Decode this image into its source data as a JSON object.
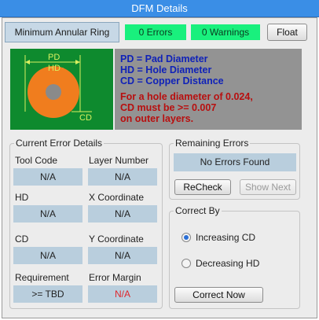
{
  "window": {
    "title": "DFM Details"
  },
  "header": {
    "tab_label": "Minimum Annular Ring",
    "errors_label": "0 Errors",
    "warnings_label": "0 Warnings",
    "float_label": "Float"
  },
  "diagram": {
    "pd_label": "PD",
    "hd_label": "HD",
    "cd_label": "CD",
    "legend_pd": "PD = Pad Diameter",
    "legend_hd": "HD = Hole Diameter",
    "legend_cd": "CD = Copper Distance",
    "note_line1": "For a hole diameter of 0.024,",
    "note_line2": "CD must be >= 0.007",
    "note_line3": "on outer layers."
  },
  "current_error": {
    "title": "Current Error Details",
    "tool_code_label": "Tool Code",
    "tool_code_value": "N/A",
    "layer_number_label": "Layer Number",
    "layer_number_value": "N/A",
    "hd_label": "HD",
    "hd_value": "N/A",
    "x_coord_label": "X Coordinate",
    "x_coord_value": "N/A",
    "cd_label": "CD",
    "cd_value": "N/A",
    "y_coord_label": "Y Coordinate",
    "y_coord_value": "N/A",
    "requirement_label": "Requirement",
    "requirement_value": ">= TBD",
    "error_margin_label": "Error Margin",
    "error_margin_value": "N/A"
  },
  "remaining": {
    "title": "Remaining Errors",
    "status": "No Errors Found",
    "recheck_label": "ReCheck",
    "show_next_label": "Show Next"
  },
  "correct_by": {
    "title": "Correct By",
    "option1": "Increasing CD",
    "option2": "Decreasing HD",
    "correct_now_label": "Correct Now"
  },
  "colors": {
    "titlebar": "#3a8ee6",
    "status_green": "#19f07d",
    "pcb_green": "#0e8a2e",
    "pad_orange": "#f07d1e",
    "legend_blue": "#1022b8",
    "note_red": "#b80f0f",
    "margin_red": "#e0262c",
    "value_field": "#b9cedd"
  }
}
